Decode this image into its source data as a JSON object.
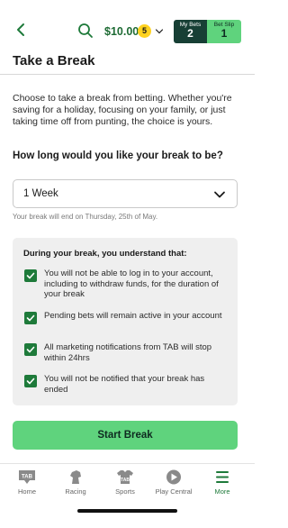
{
  "header": {
    "balance": "$10.00",
    "badge_count": "5",
    "my_bets_label": "My Bets",
    "my_bets_count": "2",
    "bet_slip_label": "Bet Slip",
    "bet_slip_count": "1"
  },
  "page": {
    "title": "Take a Break",
    "intro": "Choose to take a break from betting. Whether you're saving for a holiday, focusing on your family, or just taking time off from punting, the choice is yours.",
    "question": "How long would you like your break to be?",
    "duration_selected": "1 Week",
    "end_hint": "Your break will end on Thursday, 25th of May."
  },
  "terms": {
    "title": "During your break, you understand that:",
    "items": [
      {
        "text": "You will not be able to log in to your account, including to withdraw funds, for the duration of your break",
        "checked": true
      },
      {
        "text": "Pending bets will remain active in your account",
        "checked": true
      },
      {
        "text": "All marketing notifications from TAB will stop within 24hrs",
        "checked": true
      },
      {
        "text": "You will not be notified that your break has ended",
        "checked": true
      }
    ]
  },
  "start_button": "Start Break",
  "nav": {
    "items": [
      {
        "label": "Home",
        "icon": "tab-logo-icon",
        "active": false
      },
      {
        "label": "Racing",
        "icon": "horse-icon",
        "active": false
      },
      {
        "label": "Sports",
        "icon": "jersey-icon",
        "active": false
      },
      {
        "label": "Play Central",
        "icon": "play-icon",
        "active": false
      },
      {
        "label": "More",
        "icon": "menu-icon",
        "active": true
      }
    ]
  },
  "colors": {
    "brand_green": "#1e7a3a",
    "accent_green": "#5fd37d",
    "dark_green": "#173f35",
    "badge_yellow": "#ffd21f"
  }
}
